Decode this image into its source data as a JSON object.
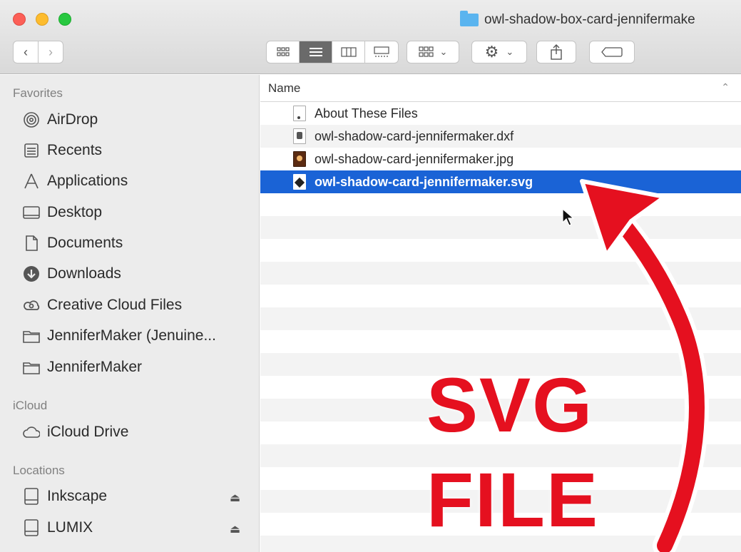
{
  "window": {
    "title": "owl-shadow-box-card-jennifermake"
  },
  "toolbar": {
    "back_icon": "chevron-left-icon",
    "forward_icon": "chevron-right-icon",
    "view_modes": [
      "icon-view",
      "list-view",
      "column-view",
      "gallery-view"
    ],
    "active_view": "list-view"
  },
  "sidebar": {
    "favorites_label": "Favorites",
    "favorites": [
      {
        "label": "AirDrop",
        "icon": "airdrop-icon"
      },
      {
        "label": "Recents",
        "icon": "recents-icon"
      },
      {
        "label": "Applications",
        "icon": "applications-icon"
      },
      {
        "label": "Desktop",
        "icon": "desktop-icon"
      },
      {
        "label": "Documents",
        "icon": "documents-icon"
      },
      {
        "label": "Downloads",
        "icon": "downloads-icon"
      },
      {
        "label": "Creative Cloud Files",
        "icon": "creative-cloud-icon"
      },
      {
        "label": "JenniferMaker (Jenuine...",
        "icon": "folder-icon"
      },
      {
        "label": "JenniferMaker",
        "icon": "folder-icon"
      }
    ],
    "icloud_label": "iCloud",
    "icloud": [
      {
        "label": "iCloud Drive",
        "icon": "cloud-icon"
      }
    ],
    "locations_label": "Locations",
    "locations": [
      {
        "label": "Inkscape",
        "icon": "disk-icon"
      },
      {
        "label": "LUMIX",
        "icon": "disk-icon"
      }
    ]
  },
  "list": {
    "column_name": "Name",
    "files": [
      {
        "name": "About These Files",
        "type": "txt"
      },
      {
        "name": "owl-shadow-card-jennifermaker.dxf",
        "type": "dxf"
      },
      {
        "name": "owl-shadow-card-jennifermaker.jpg",
        "type": "jpg"
      },
      {
        "name": "owl-shadow-card-jennifermaker.svg",
        "type": "svg",
        "selected": true
      }
    ]
  },
  "overlay": {
    "line1": "SVG",
    "line2": "FILE",
    "color": "#e5101f"
  },
  "colors": {
    "selection": "#1a63d6",
    "sidebar_bg": "#ececec"
  }
}
